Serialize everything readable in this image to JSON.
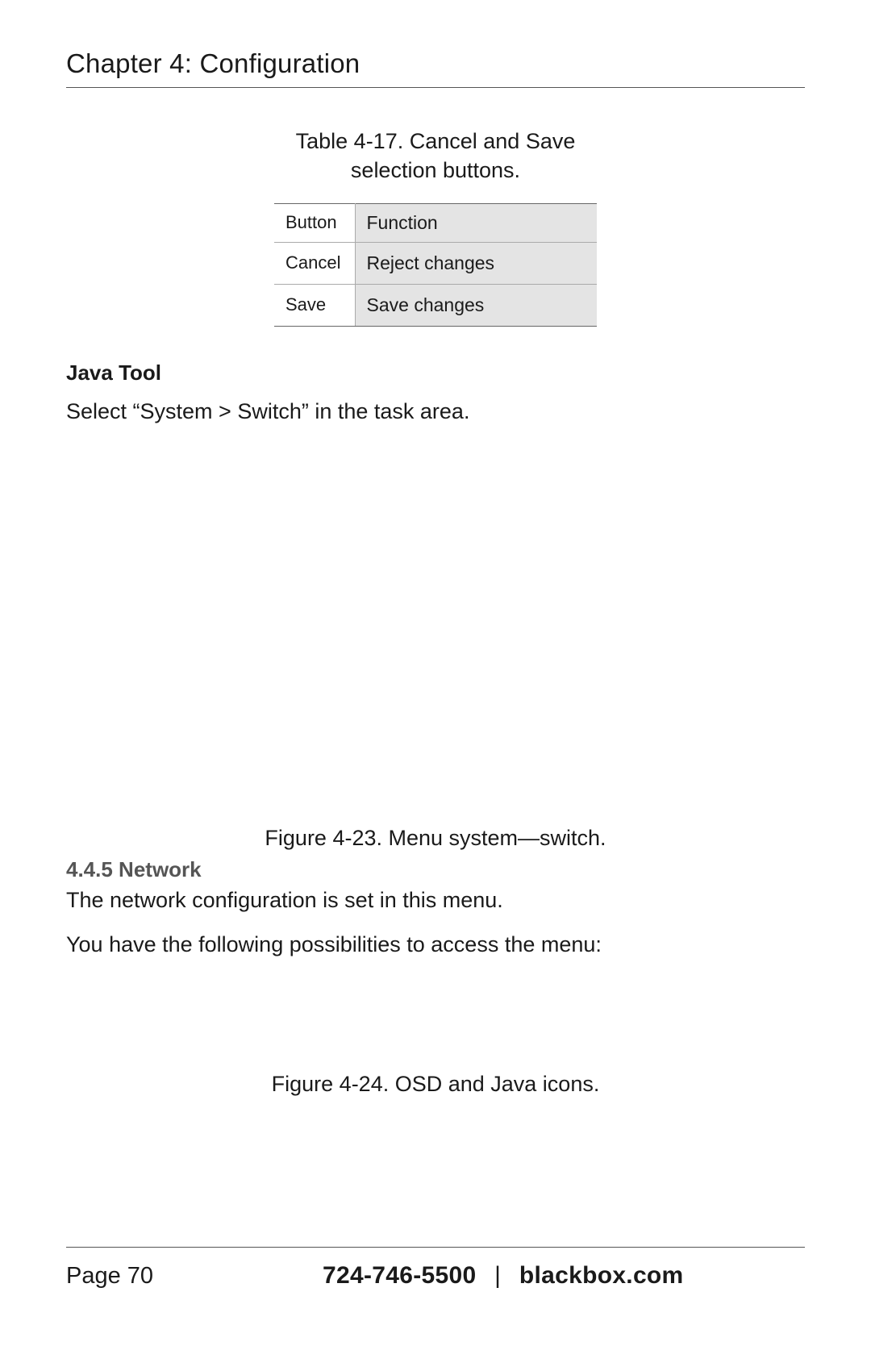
{
  "header": {
    "chapter_title": "Chapter 4: Configuration"
  },
  "table_4_17": {
    "caption_line1": "Table 4-17. Cancel and Save",
    "caption_line2": "selection buttons.",
    "headers": {
      "col1": "Button",
      "col2": "Function"
    },
    "rows": [
      {
        "button": "Cancel",
        "function": "Reject changes"
      },
      {
        "button": "Save",
        "function": "Save changes"
      }
    ]
  },
  "java_tool": {
    "heading": "Java Tool",
    "instruction": "Select “System > Switch” in the task area."
  },
  "figure_4_23": {
    "caption": "Figure 4-23. Menu system—switch."
  },
  "section_4_4_5": {
    "heading": "4.4.5 Network",
    "p1": "The network configuration is set in this menu.",
    "p2": "You have the following possibilities to access the menu:"
  },
  "figure_4_24": {
    "caption": "Figure 4-24. OSD and Java icons."
  },
  "footer": {
    "page_label": "Page 70",
    "phone": "724-746-5500",
    "separator": "|",
    "site": "blackbox.com"
  }
}
